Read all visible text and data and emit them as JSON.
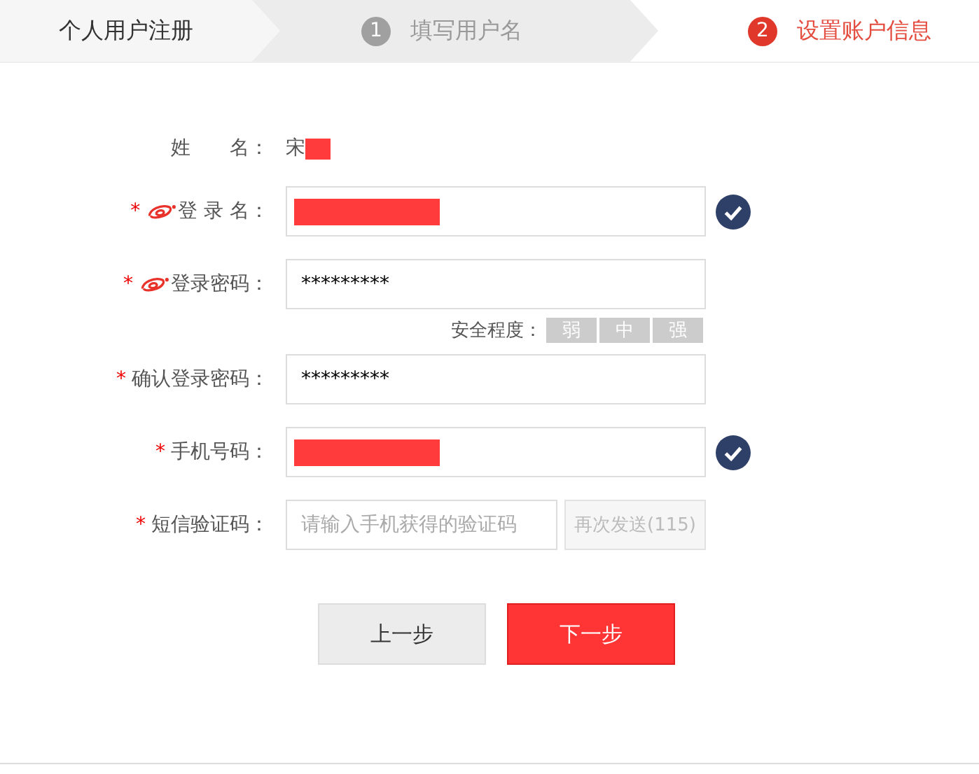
{
  "steps": [
    {
      "label": "个人用户注册",
      "selected": false,
      "disabled": false
    },
    {
      "number": "1",
      "label": "填写用户名",
      "selected": false,
      "disabled": true
    },
    {
      "number": "2",
      "label": "设置账户信息",
      "selected": true,
      "disabled": false
    }
  ],
  "form": {
    "rows": [
      {
        "kind": "text",
        "label": "姓　　名：",
        "value": "宋",
        "redacted": true
      },
      {
        "kind": "input",
        "marker": "*",
        "label": "登 录 名：",
        "logo": true,
        "redacted": true,
        "valid": true
      },
      {
        "kind": "input",
        "marker": "*",
        "label": "登录密码：",
        "logo": true,
        "value": "*********"
      },
      {
        "kind": "strength",
        "label": "安全程度：",
        "levels": [
          {
            "label": "弱",
            "on": false
          },
          {
            "label": "中",
            "on": false
          },
          {
            "label": "强",
            "on": false
          }
        ]
      },
      {
        "kind": "input",
        "marker": "*",
        "label": "确认登录密码：",
        "value": "*********"
      },
      {
        "kind": "input",
        "marker": "*",
        "label": "手机号码：",
        "redacted": true,
        "valid": true
      },
      {
        "kind": "code",
        "marker": "*",
        "label": "短信验证码：",
        "placeholder": "请输入手机获得的验证码",
        "button": "再次发送(115)",
        "disabled": true
      }
    ]
  },
  "buttons": [
    {
      "label": "上一步",
      "kind": "secondary"
    },
    {
      "label": "下一步",
      "kind": "primary"
    }
  ]
}
